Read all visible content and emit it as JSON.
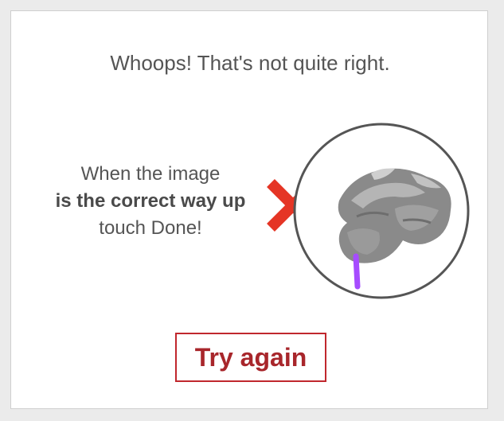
{
  "feedback": {
    "title": "Whoops! That's not quite right."
  },
  "instructions": {
    "line1": "When the image",
    "line2": "is the correct way up",
    "line3": "touch Done!"
  },
  "result_icon": "cross-icon",
  "image_icon": "sculpture-rotating-image",
  "colors": {
    "cross": "#e53525",
    "button_border": "#c0272d",
    "button_text": "#a8262b",
    "handle": "#a64bff",
    "circle_border": "#555555"
  },
  "buttons": {
    "try_again": "Try again"
  }
}
